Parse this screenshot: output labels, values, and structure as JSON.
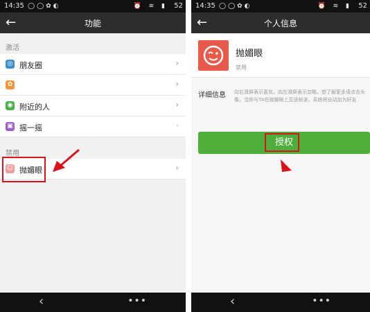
{
  "status_bar": {
    "time": "14:35",
    "battery": "52"
  },
  "left_screen": {
    "title": "功能",
    "sections": [
      {
        "label": "激活",
        "items": [
          {
            "label": "朋友圈",
            "icon": "moments-icon",
            "color": "#3f8fd0"
          },
          {
            "label": "",
            "icon": "app-icon",
            "color": "#f0943a"
          },
          {
            "label": "附近的人",
            "icon": "location-icon",
            "color": "#4caf50"
          },
          {
            "label": "摇一摇",
            "icon": "shake-icon",
            "color": "#9b5fd0"
          }
        ]
      },
      {
        "label": "禁用",
        "items": [
          {
            "label": "抛媚眼",
            "icon": "wink-icon",
            "color": "#f29d9d"
          }
        ]
      }
    ]
  },
  "right_screen": {
    "title": "个人信息",
    "profile_name": "抛媚眼",
    "profile_status": "禁用",
    "detail_label": "详细信息",
    "detail_text": "向右滑屏表示喜欢，向左滑屏表示忽略，想了解更多请点击头像，当你与TA在抛媚眼上互送秋波，系统将自动加为好友",
    "button_label": "授权"
  },
  "colors": {
    "highlight": "#d8141a",
    "button": "#4daf3a",
    "avatar": "#e85a4a",
    "titlebar": "#2d2d2d"
  }
}
